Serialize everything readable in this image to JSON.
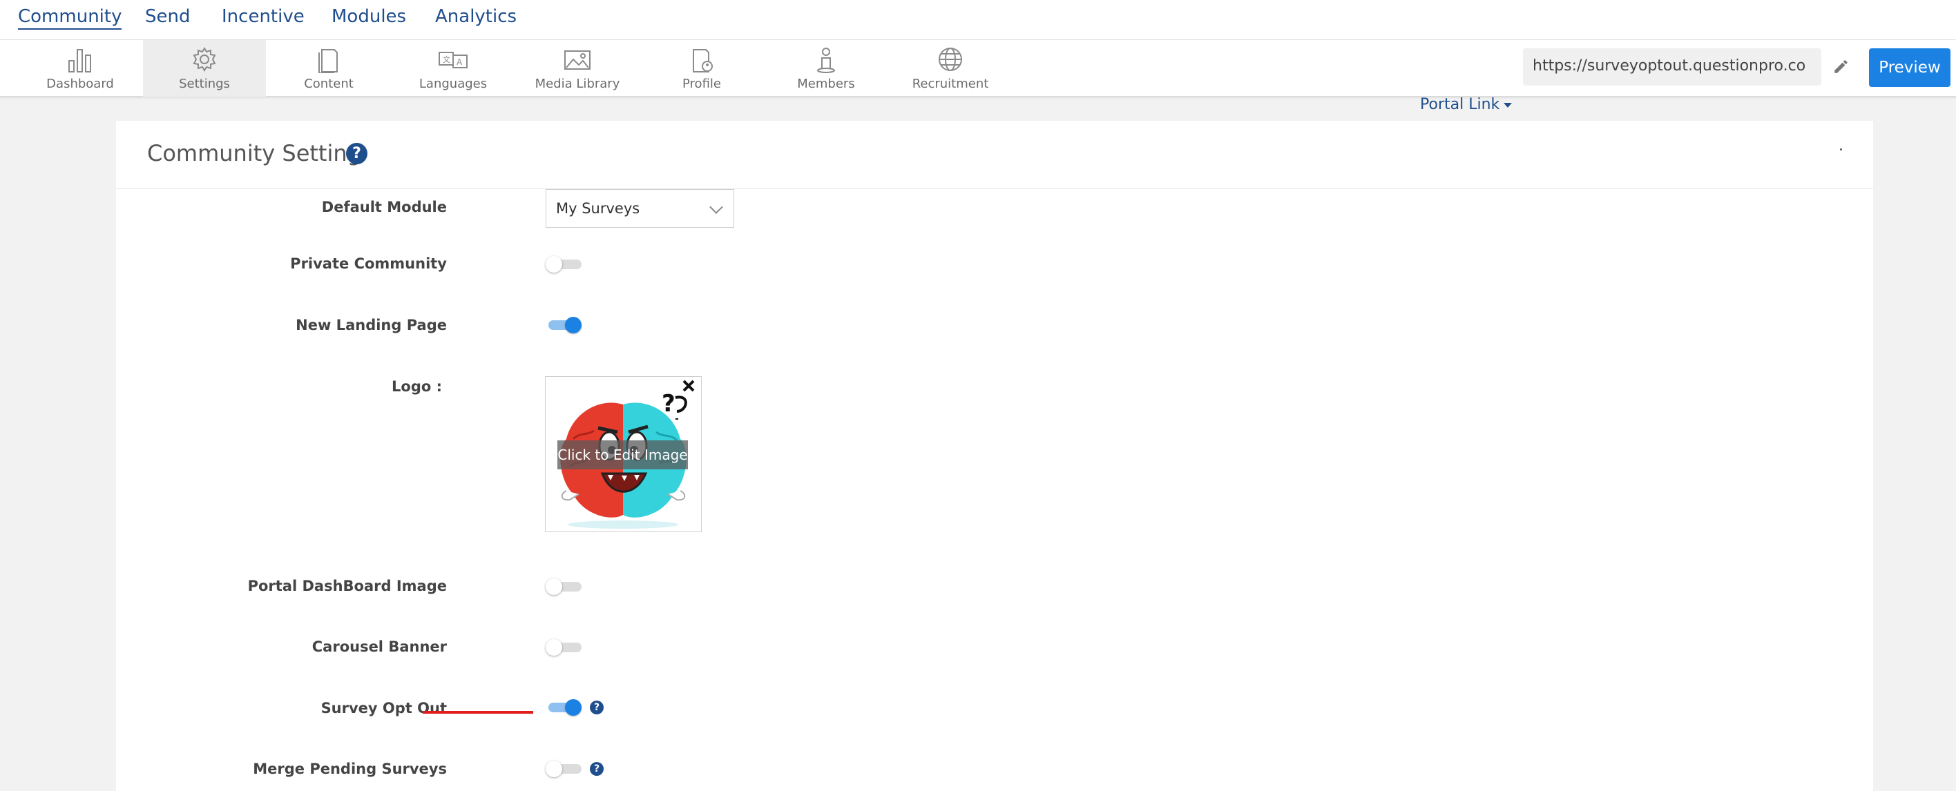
{
  "top_nav": {
    "tabs": [
      {
        "label": "Community",
        "active": true
      },
      {
        "label": "Send"
      },
      {
        "label": "Incentive"
      },
      {
        "label": "Modules"
      },
      {
        "label": "Analytics"
      }
    ]
  },
  "toolbar": {
    "items": [
      {
        "label": "Dashboard",
        "icon": "bar-chart-icon"
      },
      {
        "label": "Settings",
        "icon": "gear-icon",
        "active": true
      },
      {
        "label": "Content",
        "icon": "document-icon"
      },
      {
        "label": "Languages",
        "icon": "translate-icon"
      },
      {
        "label": "Media Library",
        "icon": "image-icon"
      },
      {
        "label": "Profile",
        "icon": "profile-icon"
      },
      {
        "label": "Members",
        "icon": "person-icon"
      },
      {
        "label": "Recruitment",
        "icon": "globe-icon"
      }
    ],
    "portal_link_label": "Portal Link",
    "url_value": "https://surveyoptout.questionpro.co",
    "preview_label": "Preview"
  },
  "card": {
    "title": "Community Setting",
    "help_glyph": "?",
    "settings": {
      "default_module": {
        "label": "Default Module",
        "value": "My Surveys"
      },
      "private_community": {
        "label": "Private Community",
        "on": false
      },
      "new_landing_page": {
        "label": "New Landing Page",
        "on": true
      },
      "logo": {
        "label": "Logo :",
        "overlay": "Click to Edit Image"
      },
      "portal_dashboard_image": {
        "label": "Portal DashBoard Image",
        "on": false
      },
      "carousel_banner": {
        "label": "Carousel Banner",
        "on": false
      },
      "survey_opt_out": {
        "label": "Survey Opt Out",
        "on": true
      },
      "merge_pending_surveys": {
        "label": "Merge Pending Surveys",
        "on": false
      }
    }
  },
  "colors": {
    "brand_blue": "#1f4e8c",
    "primary_button": "#1b82e3",
    "highlight_underline": "#e01e1e"
  }
}
